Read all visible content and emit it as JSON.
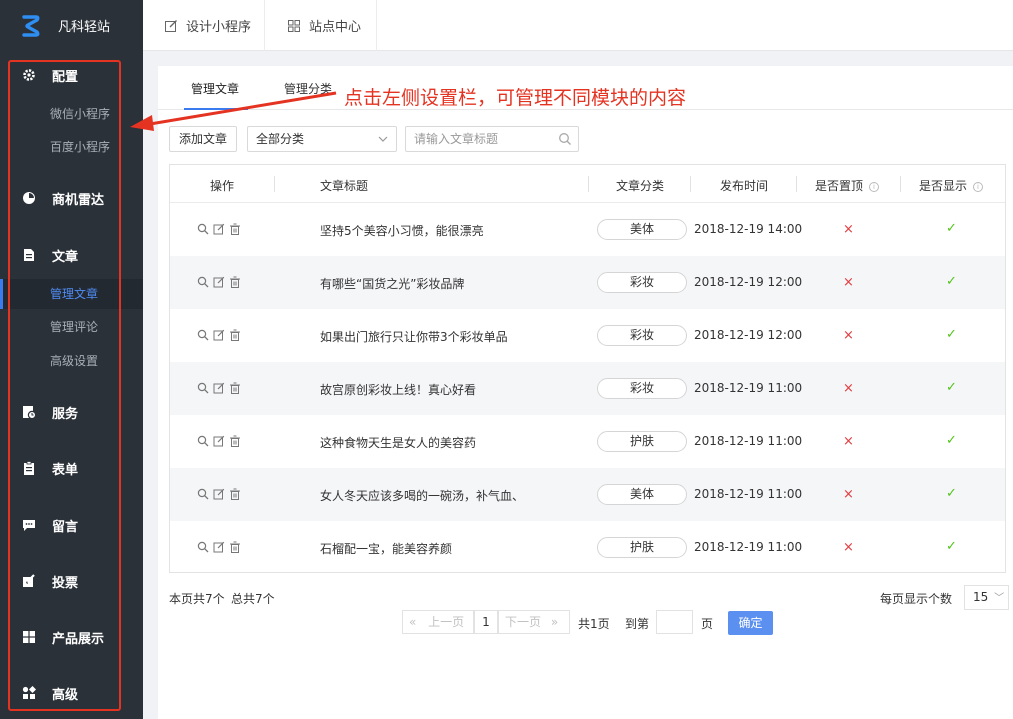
{
  "app": {
    "title": "凡科轻站"
  },
  "topbar": {
    "tabs": [
      "设计小程序",
      "站点中心"
    ]
  },
  "sidebar": {
    "groups": [
      {
        "label": "配置",
        "icon": "gear-icon"
      },
      {
        "label": "商机雷达",
        "icon": "radar-icon"
      },
      {
        "label": "文章",
        "icon": "document-icon"
      },
      {
        "label": "服务",
        "icon": "service-icon"
      },
      {
        "label": "表单",
        "icon": "clipboard-icon"
      },
      {
        "label": "留言",
        "icon": "message-icon"
      },
      {
        "label": "投票",
        "icon": "vote-icon"
      },
      {
        "label": "产品展示",
        "icon": "grid-icon"
      },
      {
        "label": "高级",
        "icon": "apps-icon"
      }
    ],
    "subitems": {
      "config": [
        "微信小程序",
        "百度小程序"
      ],
      "article": [
        "管理文章",
        "管理评论",
        "高级设置"
      ]
    },
    "active": "管理文章"
  },
  "main": {
    "tabs": [
      "管理文章",
      "管理分类"
    ],
    "annotation": "点击左侧设置栏，可管理不同模块的内容",
    "add_button": "添加文章",
    "category_select": "全部分类",
    "search_placeholder": "请输入文章标题",
    "columns": [
      "操作",
      "文章标题",
      "文章分类",
      "发布时间",
      "是否置顶",
      "是否显示"
    ],
    "rows": [
      {
        "title": "坚持5个美容小习惯，能很漂亮",
        "category": "美体",
        "time": "2018-12-19 14:00",
        "pinned": "×",
        "shown": "✓"
      },
      {
        "title": "有哪些“国货之光”彩妆品牌",
        "category": "彩妆",
        "time": "2018-12-19 12:00",
        "pinned": "×",
        "shown": "✓"
      },
      {
        "title": "如果出门旅行只让你带3个彩妆单品",
        "category": "彩妆",
        "time": "2018-12-19 12:00",
        "pinned": "×",
        "shown": "✓"
      },
      {
        "title": "故宫原创彩妆上线！真心好看",
        "category": "彩妆",
        "time": "2018-12-19 11:00",
        "pinned": "×",
        "shown": "✓"
      },
      {
        "title": "这种食物天生是女人的美容药",
        "category": "护肤",
        "time": "2018-12-19 11:00",
        "pinned": "×",
        "shown": "✓"
      },
      {
        "title": "女人冬天应该多喝的一碗汤，补气血、",
        "category": "美体",
        "time": "2018-12-19 11:00",
        "pinned": "×",
        "shown": "✓"
      },
      {
        "title": "石榴配一宝，能美容养颜",
        "category": "护肤",
        "time": "2018-12-19 11:00",
        "pinned": "×",
        "shown": "✓"
      }
    ],
    "footer": {
      "page_count": "本页共7个",
      "total_count": "总共7个",
      "per_page_label": "每页显示个数",
      "per_page_value": "15",
      "prev": "上一页",
      "next": "下一页",
      "current_page": "1",
      "total_pages": "共1页",
      "goto_label": "到第",
      "page_unit": "页",
      "confirm": "确定"
    }
  },
  "colors": {
    "accent": "#3a7cf0",
    "sidebar_bg": "#2b3139",
    "annotation": "#e53322",
    "check": "#52c41a",
    "cross": "#e4393c"
  }
}
